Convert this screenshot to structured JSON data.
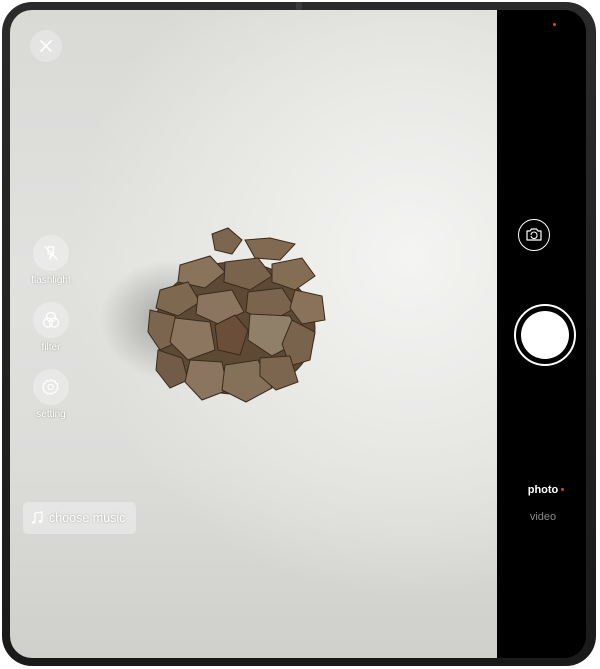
{
  "toolbar": {
    "close_icon": "close-icon",
    "tools": [
      {
        "label": "flashlight",
        "icon": "flashlight-off-icon"
      },
      {
        "label": "filter",
        "icon": "filter-icon"
      },
      {
        "label": "setting",
        "icon": "gear-icon"
      }
    ]
  },
  "music": {
    "label": "choose music",
    "icon": "music-note-icon"
  },
  "camera": {
    "modes": [
      {
        "label": "photo",
        "selected": true
      },
      {
        "label": "video",
        "selected": false
      }
    ],
    "switch_icon": "switch-camera-icon",
    "shutter_icon": "shutter-button"
  },
  "colors": {
    "accent_dot": "#e0452a",
    "panel": "#000000"
  }
}
